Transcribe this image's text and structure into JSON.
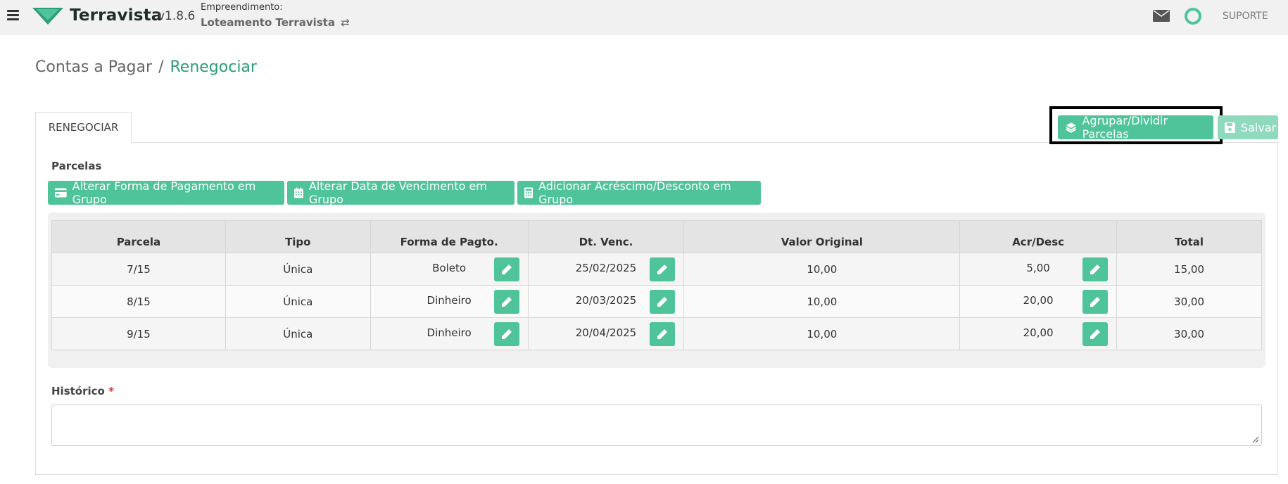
{
  "header": {
    "brand": "Terravista",
    "version": "v1.8.6",
    "empreendimento_label": "Empreendimento:",
    "empreendimento_name": "Loteamento Terravista",
    "swap_glyph": "⇄",
    "suporte": "SUPORTE",
    "accent_color": "#4fc39a"
  },
  "breadcrumb": {
    "parent": "Contas a Pagar",
    "separator": "/",
    "current": "Renegociar"
  },
  "tabs": [
    {
      "label": "RENEGOCIAR"
    }
  ],
  "toolbar": {
    "agrupar_label": "Agrupar/Dividir Parcelas",
    "salvar_label": "Salvar"
  },
  "section": {
    "parcelas_label": "Parcelas",
    "group_buttons": [
      {
        "label": "Alterar Forma de Pagamento em Grupo",
        "icon": "credit-card-icon"
      },
      {
        "label": "Alterar Data de Vencimento em Grupo",
        "icon": "calendar-icon"
      },
      {
        "label": "Adicionar Acréscimo/Desconto em Grupo",
        "icon": "calculator-icon"
      }
    ]
  },
  "table": {
    "columns": [
      "Parcela",
      "Tipo",
      "Forma de Pagto.",
      "Dt. Venc.",
      "Valor Original",
      "Acr/Desc",
      "Total"
    ],
    "rows": [
      {
        "parcela": "7/15",
        "tipo": "Única",
        "forma": "Boleto",
        "venc": "25/02/2025",
        "valor": "10,00",
        "acr": "5,00",
        "total": "15,00"
      },
      {
        "parcela": "8/15",
        "tipo": "Única",
        "forma": "Dinheiro",
        "venc": "20/03/2025",
        "valor": "10,00",
        "acr": "20,00",
        "total": "30,00"
      },
      {
        "parcela": "9/15",
        "tipo": "Única",
        "forma": "Dinheiro",
        "venc": "20/04/2025",
        "valor": "10,00",
        "acr": "20,00",
        "total": "30,00"
      }
    ]
  },
  "historico": {
    "label": "Histórico",
    "required_mark": "*",
    "value": ""
  }
}
